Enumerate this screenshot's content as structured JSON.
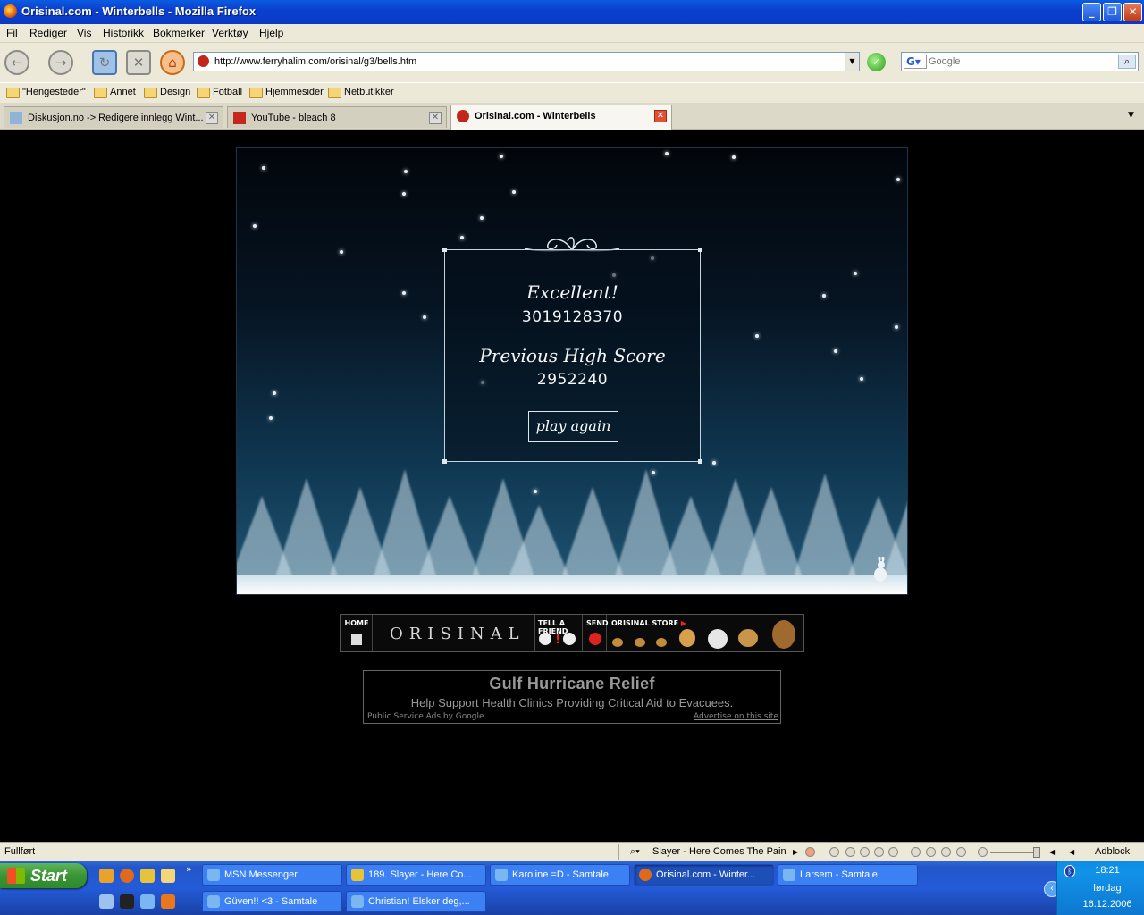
{
  "window": {
    "title": "Orisinal.com - Winterbells - Mozilla Firefox"
  },
  "menu": {
    "items": [
      "Fil",
      "Rediger",
      "Vis",
      "Historikk",
      "Bokmerker",
      "Verktøy",
      "Hjelp"
    ]
  },
  "nav": {
    "url": "http://www.ferryhalim.com/orisinal/g3/bells.htm",
    "search_placeholder": "Google"
  },
  "bookmarks": {
    "items": [
      "\"Hengesteder\"",
      "Annet",
      "Design",
      "Fotball",
      "Hjemmesider",
      "Netbutikker"
    ]
  },
  "tabs": [
    {
      "label": "Diskusjon.no -> Redigere innlegg Wint...",
      "active": false
    },
    {
      "label": "YouTube - bleach 8",
      "active": false
    },
    {
      "label": "Orisinal.com - Winterbells",
      "active": true
    }
  ],
  "game": {
    "heading": "Excellent!",
    "score": "3019128370",
    "prev_label": "Previous High Score",
    "prev_score": "2952240",
    "play_again": "play again"
  },
  "orisinal_nav": {
    "home": "HOME",
    "logo": "ORISINAL",
    "tell_a_friend": "TELL A FRIEND",
    "send": "SEND",
    "store": "ORISINAL STORE"
  },
  "ad": {
    "headline": "Gulf Hurricane Relief",
    "body": "Help Support Health Clinics Providing Critical Aid to Evacuees.",
    "left_link": "Public Service Ads by Google",
    "right_link": "Advertise on this site"
  },
  "status": {
    "text": "Fullført",
    "media": "Slayer - Here Comes The Pain",
    "adblock": "Adblock"
  },
  "taskbar": {
    "start": "Start",
    "buttons_row1": [
      {
        "label": "MSN Messenger",
        "active": false
      },
      {
        "label": "189. Slayer - Here Co...",
        "active": false
      },
      {
        "label": "Karoline =D - Samtale",
        "active": false
      },
      {
        "label": "Orisinal.com - Winter...",
        "active": true
      },
      {
        "label": "Larsem - Samtale",
        "active": false
      }
    ],
    "buttons_row2": [
      {
        "label": "Güven!! <3 - Samtale",
        "active": false
      },
      {
        "label": "Christian! Elsker deg,...",
        "active": false
      }
    ],
    "clock": {
      "time": "18:21",
      "day": "lørdag",
      "date": "16.12.2006"
    }
  }
}
